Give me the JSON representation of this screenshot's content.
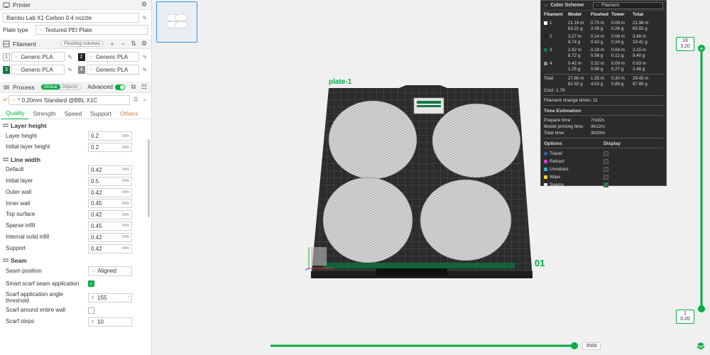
{
  "printer": {
    "title": "Printer",
    "name": "Bambu Lab X1 Carbon 0.4 nozzle",
    "plate_type_label": "Plate type",
    "plate_type": "Textured PEI Plate"
  },
  "filament": {
    "title": "Filament",
    "flushing_label": "Flushing volumes",
    "items": [
      {
        "num": "1",
        "name": "Generic PLA",
        "color": "#ffffff"
      },
      {
        "num": "2",
        "name": "Generic PLA",
        "color": "#222222"
      },
      {
        "num": "3",
        "name": "Generic PLA",
        "color": "#0f7a45"
      },
      {
        "num": "4",
        "name": "Generic PLA",
        "color": "#8c8c8c"
      }
    ]
  },
  "process": {
    "title": "Process",
    "global_label": "Global",
    "objects_label": "Objects",
    "advanced_label": "Advanced",
    "preset": "* 0.20mm Standard @BBL X1C",
    "tabs": [
      "Quality",
      "Strength",
      "Speed",
      "Support",
      "Others"
    ],
    "groups": {
      "layer_height": {
        "title": "Layer height",
        "rows": [
          {
            "label": "Layer height",
            "value": "0.2",
            "unit": "mm"
          },
          {
            "label": "Initial layer height",
            "value": "0.2",
            "unit": "mm"
          }
        ]
      },
      "line_width": {
        "title": "Line width",
        "rows": [
          {
            "label": "Default",
            "value": "0.42",
            "unit": "mm"
          },
          {
            "label": "Initial layer",
            "value": "0.5",
            "unit": "mm"
          },
          {
            "label": "Outer wall",
            "value": "0.42",
            "unit": "mm"
          },
          {
            "label": "Inner wall",
            "value": "0.45",
            "unit": "mm"
          },
          {
            "label": "Top surface",
            "value": "0.42",
            "unit": "mm"
          },
          {
            "label": "Sparse infill",
            "value": "0.45",
            "unit": "mm"
          },
          {
            "label": "Internal solid infill",
            "value": "0.42",
            "unit": "mm"
          },
          {
            "label": "Support",
            "value": "0.42",
            "unit": "mm"
          }
        ]
      },
      "seam": {
        "title": "Seam",
        "seam_position_label": "Seam position",
        "seam_position": "Aligned",
        "smart_scarf_label": "Smart scarf seam application",
        "scarf_angle_label": "Scarf application angle threshold",
        "scarf_angle": "155",
        "scarf_around_label": "Scarf around entire wall",
        "scarf_steps_label": "Scarf steps",
        "scarf_steps": "10"
      }
    }
  },
  "viewport": {
    "plate_label": "plate-1",
    "plate_number": "01"
  },
  "legend": {
    "title": "Color Scheme",
    "scheme": "Filament",
    "headers": [
      "Filament",
      "Model",
      "Flushed",
      "Tower",
      "Total"
    ],
    "rows": [
      {
        "id": "1",
        "color": "#ffffff",
        "model": [
          "21.19 m",
          "63.21 g"
        ],
        "flushed": [
          "0.70 m",
          "2.08 g"
        ],
        "tower": [
          "0.09 m",
          "0.26 g"
        ],
        "total": [
          "21.98 m",
          "65.55 g"
        ]
      },
      {
        "id": "2",
        "color": "#222222",
        "model": [
          "3.27 m",
          "9.74 g"
        ],
        "flushed": [
          "0.14 m",
          "0.43 g"
        ],
        "tower": [
          "0.08 m",
          "0.24 g"
        ],
        "total": [
          "3.49 m",
          "10.41 g"
        ]
      },
      {
        "id": "3",
        "color": "#0f7a45",
        "model": [
          "2.92 m",
          "8.72 g"
        ],
        "flushed": [
          "0.19 m",
          "0.56 g"
        ],
        "tower": [
          "0.04 m",
          "0.12 g"
        ],
        "total": [
          "3.15 m",
          "9.40 g"
        ]
      },
      {
        "id": "4",
        "color": "#8c8c8c",
        "model": [
          "0.42 m",
          "1.25 g"
        ],
        "flushed": [
          "0.32 m",
          "0.96 g"
        ],
        "tower": [
          "0.09 m",
          "0.27 g"
        ],
        "total": [
          "0.83 m",
          "2.48 g"
        ]
      }
    ],
    "total_row": {
      "label": "Total",
      "model": [
        "27.80 m",
        "82.92 g"
      ],
      "flushed": [
        "1.35 m",
        "4.03 g"
      ],
      "tower": [
        "0.30 m",
        "0.89 g"
      ],
      "total": [
        "29.45 m",
        "87.85 g"
      ]
    },
    "cost": "Cost:  1.76",
    "filament_change": "Filament change times:  11",
    "time_title": "Time Estimation",
    "prepare_label": "Prepare time:",
    "prepare": "7m32s",
    "printing_label": "Model printing time:",
    "printing": "3h12m",
    "total_label": "Total time:",
    "total": "3h20m",
    "options_label": "Options",
    "display_label": "Display",
    "options": [
      {
        "name": "Travel",
        "color": "#3a56a8",
        "on": false
      },
      {
        "name": "Retract",
        "color": "#d43ad4",
        "on": false
      },
      {
        "name": "Unretract",
        "color": "#2fb2c8",
        "on": false
      },
      {
        "name": "Wipe",
        "color": "#e8d81c",
        "on": false
      },
      {
        "name": "Seams",
        "color": "#e8e8e8",
        "on": true
      }
    ]
  },
  "sliders": {
    "layer_top_num": "16",
    "layer_top_h": "3.20",
    "layer_bottom_num": "1",
    "layer_bottom_h": "0.20",
    "move_value": "3566"
  },
  "colors": {
    "accent": "#00ae42",
    "warn": "#e07b2e"
  }
}
